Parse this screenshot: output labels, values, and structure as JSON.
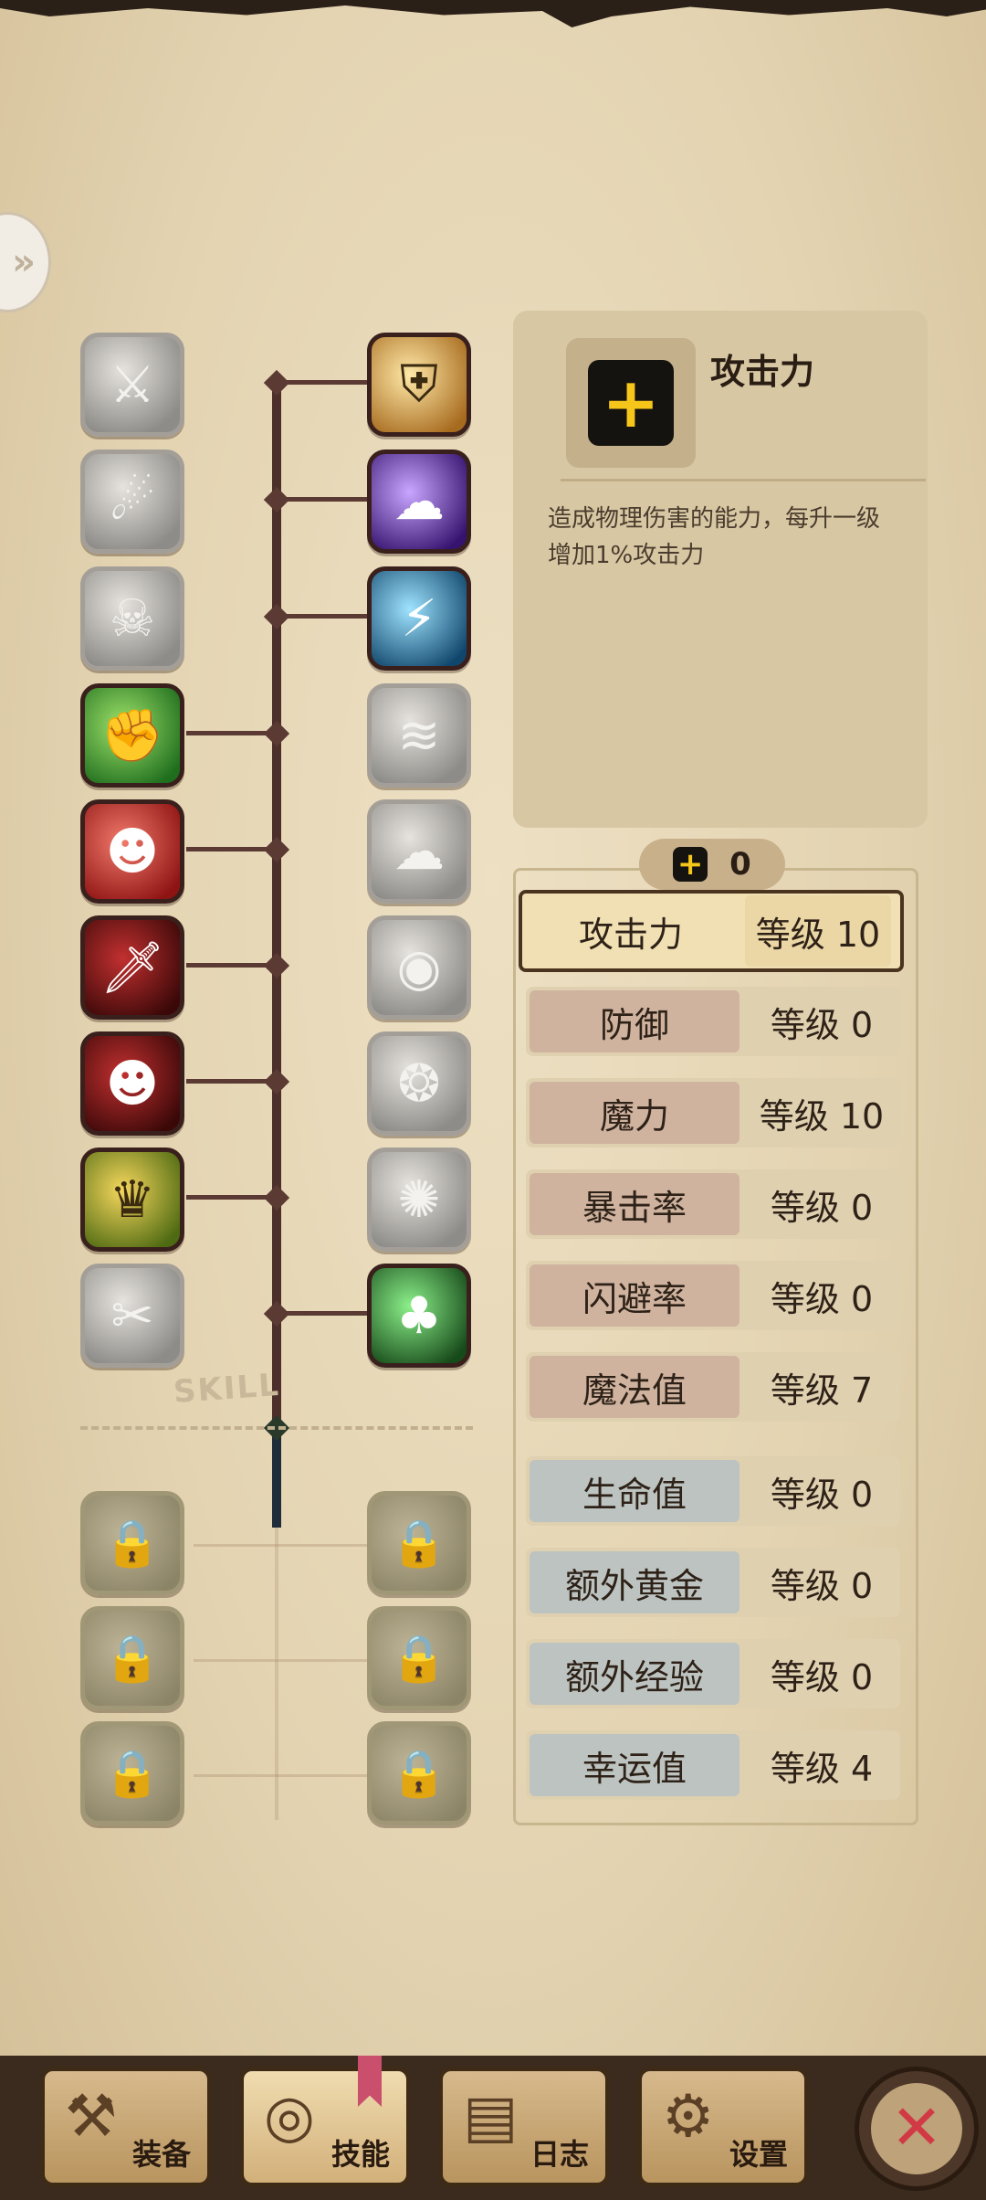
{
  "skill_tree": {
    "label": "SKILL",
    "left_column": [
      {
        "name": "blade-slash-skill-icon",
        "glyph": "⚔",
        "state": "locked-gray"
      },
      {
        "name": "dash-kick-skill-icon",
        "glyph": "☄",
        "state": "locked-gray"
      },
      {
        "name": "roar-skill-icon",
        "glyph": "☠",
        "state": "locked-gray"
      },
      {
        "name": "strength-flex-skill-icon",
        "glyph": "✊",
        "state": "unlocked"
      },
      {
        "name": "berserk-skill-icon",
        "glyph": "☻",
        "state": "unlocked"
      },
      {
        "name": "dagger-strike-skill-icon",
        "glyph": "🗡",
        "state": "unlocked"
      },
      {
        "name": "shadow-assassin-skill-icon",
        "glyph": "☻",
        "state": "unlocked"
      },
      {
        "name": "golden-armor-skill-icon",
        "glyph": "♛",
        "state": "unlocked"
      },
      {
        "name": "cross-blades-skill-icon",
        "glyph": "✂",
        "state": "locked-gray"
      }
    ],
    "right_column": [
      {
        "name": "holy-shield-skill-icon",
        "glyph": "⛨",
        "state": "unlocked"
      },
      {
        "name": "dark-ghost-skill-icon",
        "glyph": "☁",
        "state": "unlocked"
      },
      {
        "name": "lightning-skill-icon",
        "glyph": "⚡",
        "state": "unlocked"
      },
      {
        "name": "wind-rush-skill-icon",
        "glyph": "≋",
        "state": "locked-gray"
      },
      {
        "name": "smoke-bomb-skill-icon",
        "glyph": "☁",
        "state": "locked-gray"
      },
      {
        "name": "eye-orb-skill-icon",
        "glyph": "◉",
        "state": "locked-gray"
      },
      {
        "name": "whirlwind-skill-icon",
        "glyph": "❂",
        "state": "locked-gray"
      },
      {
        "name": "explosion-skill-icon",
        "glyph": "✺",
        "state": "locked-gray"
      },
      {
        "name": "clover-luck-skill-icon",
        "glyph": "♣",
        "state": "unlocked"
      }
    ],
    "locked_rows": [
      {
        "left": "🔒",
        "right": "🔒"
      },
      {
        "left": "🔒",
        "right": "🔒"
      },
      {
        "left": "🔒",
        "right": "🔒"
      }
    ]
  },
  "info": {
    "icon_glyph": "+",
    "title": "攻击力",
    "description": "造成物理伤害的能力，每升一级增加1%攻击力"
  },
  "points": {
    "icon_glyph": "+",
    "value": "0"
  },
  "stats": [
    {
      "name": "攻击力",
      "level": "等级 10",
      "group": "selected"
    },
    {
      "name": "防御",
      "level": "等级 0",
      "group": "red"
    },
    {
      "name": "魔力",
      "level": "等级 10",
      "group": "red"
    },
    {
      "name": "暴击率",
      "level": "等级 0",
      "group": "red"
    },
    {
      "name": "闪避率",
      "level": "等级 0",
      "group": "red"
    },
    {
      "name": "魔法值",
      "level": "等级 7",
      "group": "red"
    },
    {
      "name": "生命值",
      "level": "等级 0",
      "group": "blue"
    },
    {
      "name": "额外黄金",
      "level": "等级 0",
      "group": "blue"
    },
    {
      "name": "额外经验",
      "level": "等级 0",
      "group": "blue"
    },
    {
      "name": "幸运值",
      "level": "等级 4",
      "group": "blue"
    }
  ],
  "nav": {
    "equip": {
      "label": "装备",
      "icon": "axe-icon"
    },
    "skills": {
      "label": "技能",
      "icon": "skill-emblem-icon"
    },
    "log": {
      "label": "日志",
      "icon": "scroll-icon"
    },
    "settings": {
      "label": "设置",
      "icon": "gear-icon"
    },
    "close_glyph": "✕"
  },
  "colors": {
    "accent_gold": "#f7c61a",
    "close_red": "#d13a45",
    "trunk": "#4c2f2a"
  }
}
